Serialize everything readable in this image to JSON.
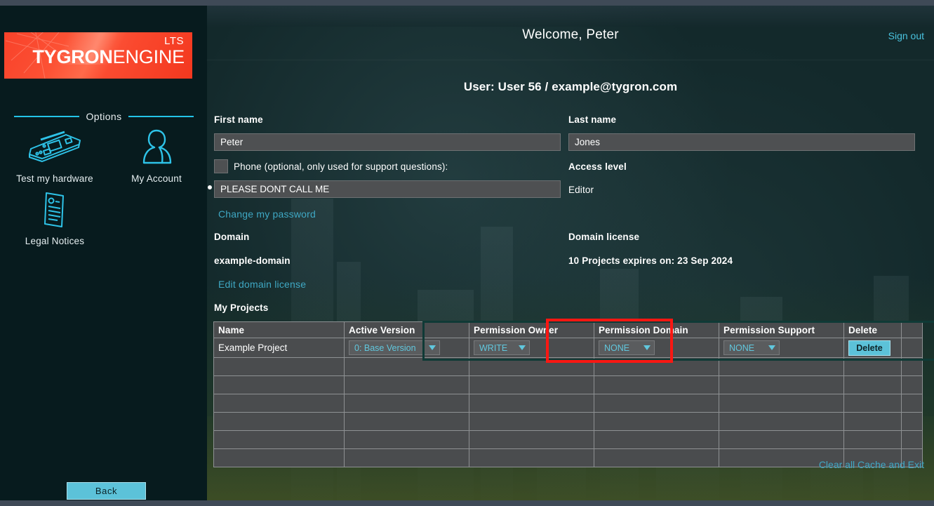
{
  "sidebar": {
    "logo": {
      "lts": "LTS",
      "brand_bold": "TYGRON",
      "brand_light": "ENGINE"
    },
    "options_divider": "Options",
    "options": [
      {
        "label": "Test my hardware",
        "icon": "circuit-board-icon"
      },
      {
        "label": "My Account",
        "icon": "user-icon"
      },
      {
        "label": "Legal Notices",
        "icon": "document-icon"
      }
    ],
    "back_button": "Back"
  },
  "header": {
    "welcome": "Welcome, Peter",
    "sign_out": "Sign out",
    "user_line": "User: User 56 / example@tygron.com"
  },
  "form": {
    "first_name_label": "First name",
    "first_name_value": "Peter",
    "last_name_label": "Last name",
    "last_name_value": "Jones",
    "phone_checkbox_label": "Phone (optional, only used for support questions):",
    "phone_value": "PLEASE DONT CALL ME",
    "change_password_link": "Change my password",
    "access_level_label": "Access level",
    "access_level_value": "Editor",
    "domain_label": "Domain",
    "domain_value": "example-domain",
    "domain_license_label": "Domain license",
    "domain_license_value": "10 Projects expires on: 23 Sep 2024",
    "edit_domain_license_link": "Edit domain license"
  },
  "projects": {
    "section_title": "My Projects",
    "columns": [
      "Name",
      "Active Version",
      "Permission Owner",
      "Permission Domain",
      "Permission Support",
      "Delete"
    ],
    "rows": [
      {
        "name": "Example Project",
        "active_version": "0: Base Version",
        "permission_owner": "WRITE",
        "permission_domain": "NONE",
        "permission_support": "NONE",
        "delete_label": "Delete"
      }
    ],
    "empty_row_count": 6
  },
  "footer": {
    "clear_cache_link": "Clear all Cache and Exit"
  },
  "colors": {
    "accent_cyan": "#5cc2d9",
    "link_blue": "#3fa8c4",
    "brand_red": "#fb4b30",
    "annotation_red": "#fb1712",
    "panel_bg": "#102a2c",
    "sidebar_bg": "#071b1e",
    "table_bg": "#4a4c4e"
  }
}
